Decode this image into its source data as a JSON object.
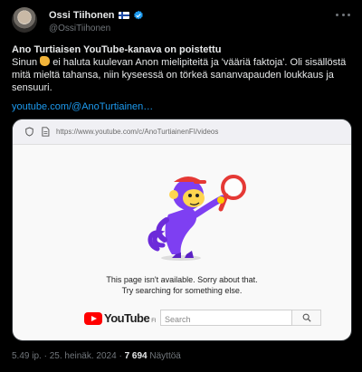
{
  "author": {
    "display_name": "Ossi Tiihonen",
    "handle": "@OssiTiihonen",
    "flag_icon": "finnish-flag-icon",
    "verified_icon": "verified-badge-icon",
    "verified_color": "#1d9bf0"
  },
  "tweet": {
    "title": "Ano Turtiaisen YouTube-kanava on poistettu",
    "body_prefix": "Sinun ",
    "body_emoji": "pointing-hand-emoji",
    "body_rest": " ei haluta kuulevan Anon mielipiteitä ja 'vääriä faktoja'. Oli sisällöstä mitä mieltä tahansa, niin kyseessä on törkeä sananvapauden loukkaus ja sensuuri.",
    "link_text": "youtube.com/@AnoTurtiainen…",
    "link_color": "#1d9bf0"
  },
  "embedded_screenshot": {
    "url_text": "https://www.youtube.com/c/AnoTurtiainenFI/videos",
    "message_line_1": "This page isn't available. Sorry about that.",
    "message_line_2": "Try searching for something else.",
    "logo_text": "YouTube",
    "logo_country": "FI",
    "search_placeholder": "Search",
    "brand_red": "#ff0000"
  },
  "meta": {
    "time": "5.49 ip.",
    "separator": "·",
    "date": "25. heinäk. 2024",
    "separator2": "·",
    "views": "7 694",
    "views_label": "Näyttöä"
  }
}
